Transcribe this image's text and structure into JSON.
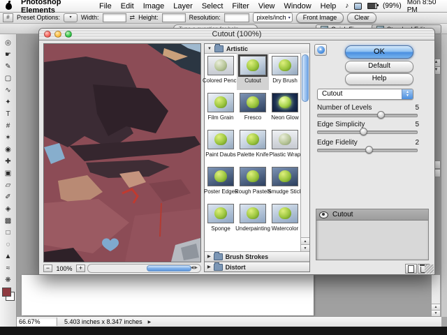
{
  "menu_bar": {
    "app_name": "Photoshop Elements",
    "items": [
      "File",
      "Edit",
      "Image",
      "Layer",
      "Select",
      "Filter",
      "View",
      "Window",
      "Help"
    ],
    "battery": "(99%)",
    "clock": "Mon 8:50 PM"
  },
  "options_bar": {
    "preset_label": "Preset Options:",
    "width_label": "Width:",
    "height_label": "Height:",
    "resolution_label": "Resolution:",
    "resolution_unit": "pixels/inch",
    "front_image_button": "Front Image",
    "clear_button": "Clear"
  },
  "shortcut_bar": {
    "help_placeholder": "Type a question for help",
    "quick_fix": "Quick Fix",
    "standard_edit": "Standard Edit"
  },
  "tools": [
    {
      "name": "move",
      "glyph": "✥"
    },
    {
      "name": "zoom",
      "glyph": "◎"
    },
    {
      "name": "hand",
      "glyph": "☛"
    },
    {
      "name": "eyedropper",
      "glyph": "✎"
    },
    {
      "name": "marquee",
      "glyph": "▢"
    },
    {
      "name": "lasso",
      "glyph": "∿"
    },
    {
      "name": "magic-wand",
      "glyph": "✦"
    },
    {
      "name": "type",
      "glyph": "T"
    },
    {
      "name": "crop",
      "glyph": "#"
    },
    {
      "name": "cookie-cutter",
      "glyph": "✶"
    },
    {
      "name": "red-eye",
      "glyph": "◉"
    },
    {
      "name": "healing-brush",
      "glyph": "✚"
    },
    {
      "name": "clone-stamp",
      "glyph": "▣"
    },
    {
      "name": "eraser",
      "glyph": "▱"
    },
    {
      "name": "brush",
      "glyph": "✐"
    },
    {
      "name": "paint-bucket",
      "glyph": "◈"
    },
    {
      "name": "gradient",
      "glyph": "▩"
    },
    {
      "name": "shape",
      "glyph": "□"
    },
    {
      "name": "blur",
      "glyph": "◌"
    },
    {
      "name": "sharpen",
      "glyph": "▲"
    },
    {
      "name": "smudge",
      "glyph": "≈"
    },
    {
      "name": "sponge",
      "glyph": "❋"
    }
  ],
  "dialog": {
    "title": "Cutout (100%)",
    "zoom": {
      "minus": "−",
      "value": "100%",
      "plus": "+"
    },
    "categories": {
      "artistic": "Artistic",
      "brush_strokes": "Brush Strokes",
      "distort": "Distort"
    },
    "filters": [
      "Colored Pencil",
      "Cutout",
      "Dry Brush",
      "Film Grain",
      "Fresco",
      "Neon Glow",
      "Paint Daubs",
      "Palette Knife",
      "Plastic Wrap",
      "Poster Edges",
      "Rough Pastels",
      "Smudge Stick",
      "Sponge",
      "Underpainting",
      "Watercolor"
    ],
    "selected_filter": "Cutout",
    "buttons": {
      "ok": "OK",
      "default": "Default",
      "help": "Help"
    },
    "filter_popup": "Cutout",
    "sliders": [
      {
        "label": "Number of Levels",
        "value": "5",
        "thumb_style": "left:60%"
      },
      {
        "label": "Edge Simplicity",
        "value": "5",
        "thumb_style": "left:42%"
      },
      {
        "label": "Edge Fidelity",
        "value": "2",
        "thumb_style": "left:48%"
      }
    ],
    "effect_layers": [
      "Cutout"
    ]
  },
  "status_bar": {
    "zoom": "66.67%",
    "doc_size": "5.403 inches x 8.347 inches"
  },
  "icons": {
    "up": "▲",
    "down": "▼",
    "left": "◀",
    "right": "▶",
    "popup_down": "▾",
    "swap": "⇄",
    "note": "♪",
    "arrows_lr": "◀▶"
  },
  "colors": {
    "aqua_blue": "#4a8fe0",
    "preview_bg": "#8c4c56",
    "foreground_swatch": "#8e3a40"
  }
}
